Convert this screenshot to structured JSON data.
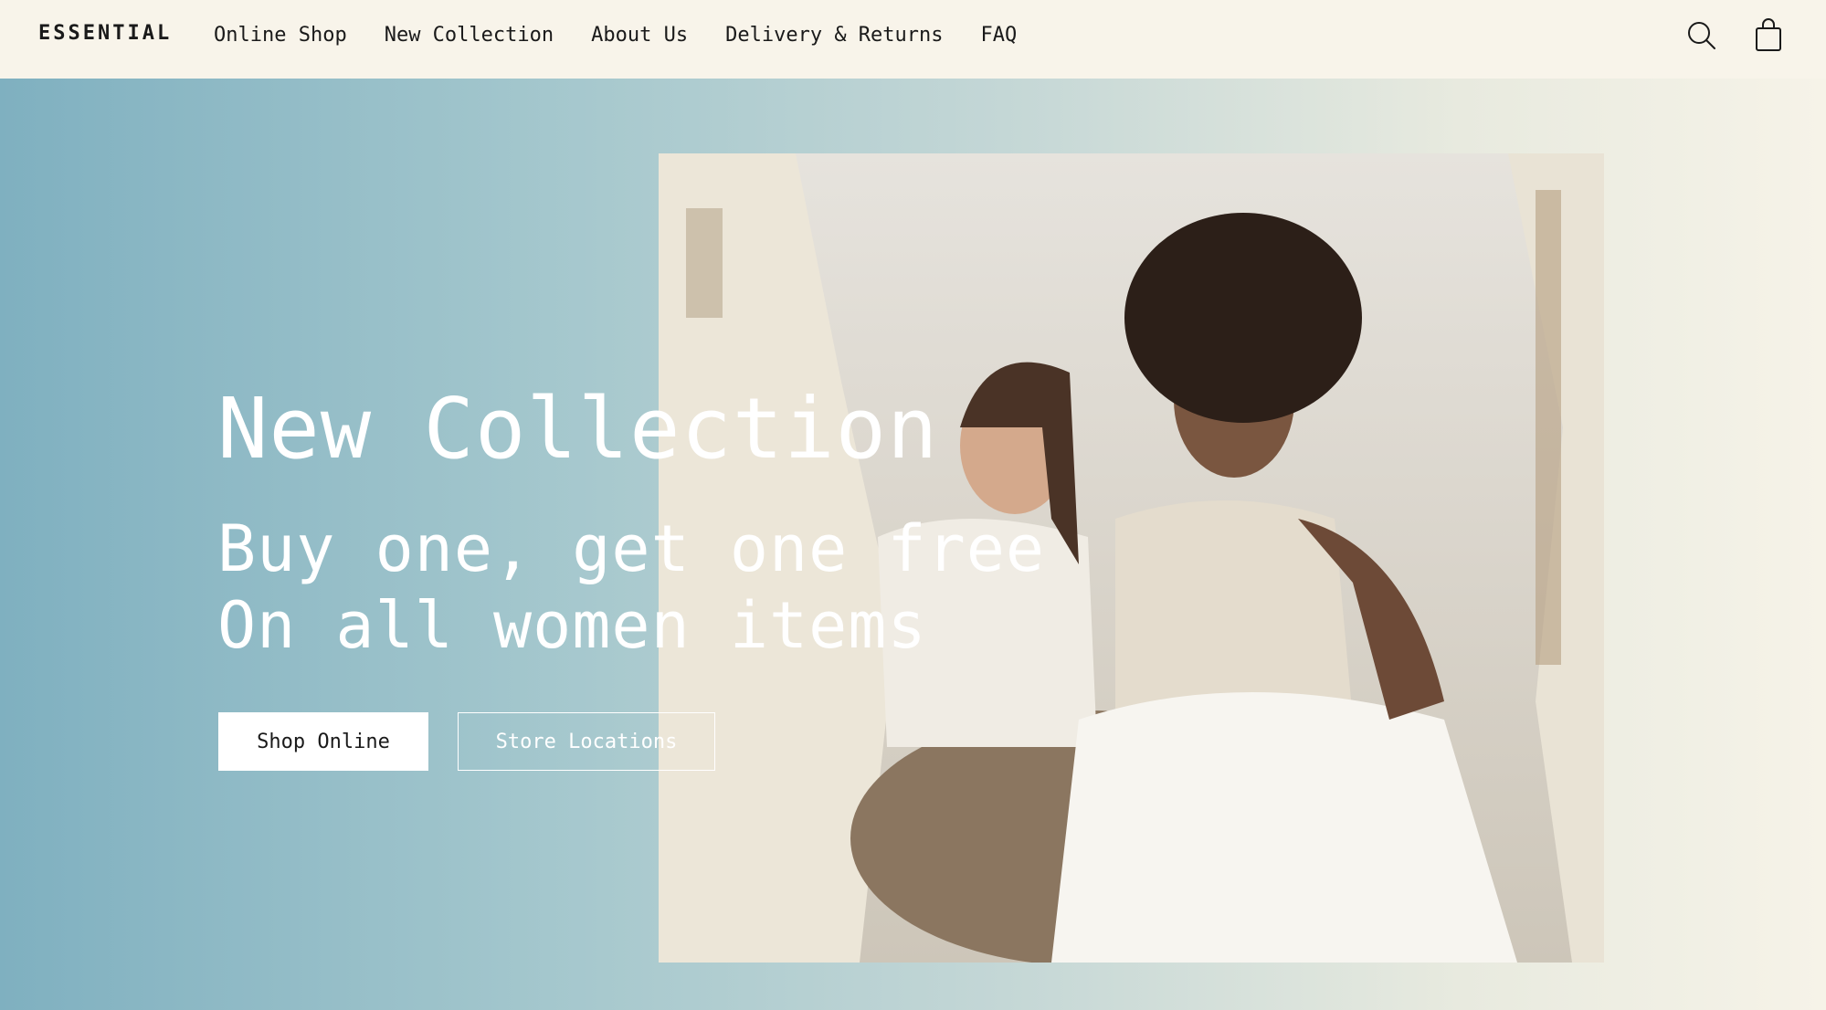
{
  "brand": {
    "logo_text": "ESSENTIAL"
  },
  "nav": {
    "items": [
      {
        "label": "Online Shop"
      },
      {
        "label": "New Collection"
      },
      {
        "label": "About Us"
      },
      {
        "label": "Delivery & Returns"
      },
      {
        "label": "FAQ"
      }
    ],
    "icons": [
      "search-icon",
      "shopping-bag-icon"
    ]
  },
  "hero": {
    "title": "New Collection",
    "subtitle_line1": "Buy one, get one free",
    "subtitle_line2": "On all women items",
    "primary_button": "Shop Online",
    "secondary_button": "Store Locations",
    "image": "two-women-seated-back-to-back-photo"
  },
  "colors": {
    "nav_background": "#f8f4ea",
    "gradient_start": "#7fb0c0",
    "gradient_end": "#f6f3e8",
    "text_dark": "#1a1a1a",
    "text_light": "#ffffff"
  }
}
